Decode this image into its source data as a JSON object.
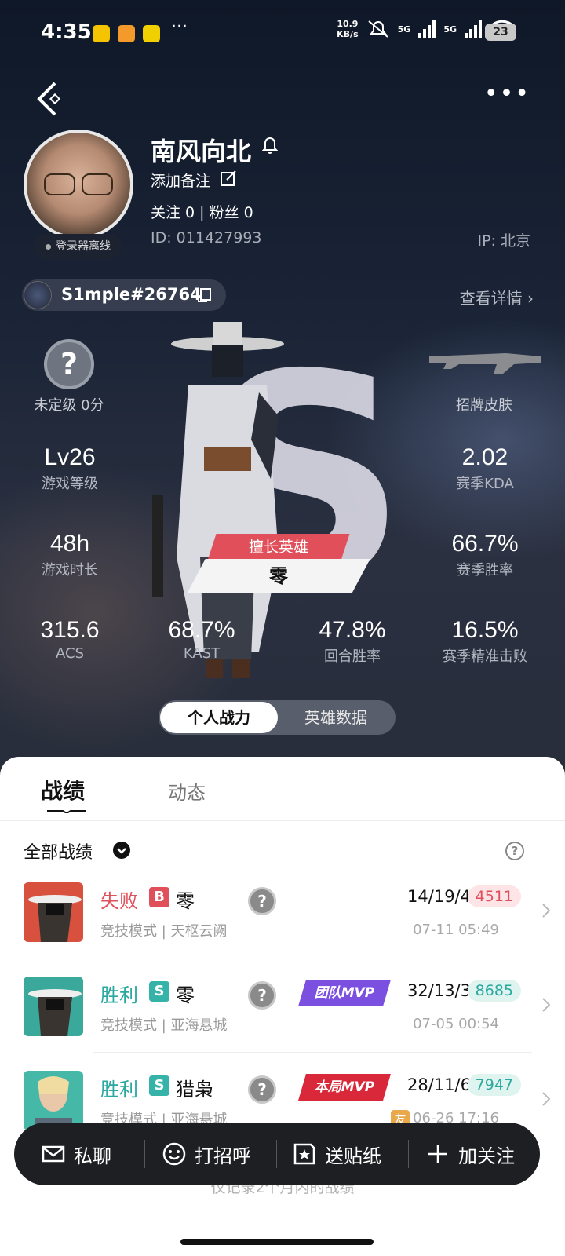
{
  "status_bar": {
    "time": "4:35",
    "net_speed_value": "10.9",
    "net_speed_unit": "KB/s",
    "sig1": "5G",
    "sig2": "5G",
    "wifi_sub": "6",
    "battery": "23"
  },
  "profile": {
    "nickname": "南风向北",
    "remark": "添加备注",
    "follow_text": "关注 0  |  粉丝 0",
    "id": "ID: 011427993",
    "ip": "IP: 北京",
    "client_status": "登录器离线",
    "riot_id": "S1mple#26764",
    "detail_link": "查看详情"
  },
  "stats": {
    "rank_label": "未定级 0分",
    "skin_label": "招牌皮肤",
    "level": {
      "value": "Lv26",
      "label": "游戏等级"
    },
    "kda": {
      "value": "2.02",
      "label": "赛季KDA"
    },
    "hours": {
      "value": "48h",
      "label": "游戏时长"
    },
    "winrate": {
      "value": "66.7%",
      "label": "赛季胜率"
    },
    "acs": {
      "value": "315.6",
      "label": "ACS"
    },
    "kast": {
      "value": "68.7%",
      "label": "KAST"
    },
    "round_win": {
      "value": "47.8%",
      "label": "回合胜率"
    },
    "headshot": {
      "value": "16.5%",
      "label": "赛季精准击败"
    },
    "fav_tag": "擅长英雄",
    "fav_agent": "零"
  },
  "toggle": {
    "active": "个人战力",
    "inactive": "英雄数据"
  },
  "tabs": {
    "records": "战绩",
    "feed": "动态"
  },
  "filter": {
    "label": "全部战绩"
  },
  "matches": [
    {
      "result": "失败",
      "badge": "B",
      "agent": "零",
      "mode": "竞技模式 | 天枢云阙",
      "kda": "14/19/4",
      "score": "4511",
      "date": "07-11 05:49",
      "mvp": ""
    },
    {
      "result": "胜利",
      "badge": "S",
      "agent": "零",
      "mode": "竞技模式 | 亚海悬城",
      "kda": "32/13/3",
      "score": "8685",
      "date": "07-05 00:54",
      "mvp": "团队MVP"
    },
    {
      "result": "胜利",
      "badge": "S",
      "agent": "猎枭",
      "mode": "竞技模式 | 亚海悬城",
      "kda": "28/11/6",
      "score": "7947",
      "date": "06-26 17:16",
      "mvp": "本局MVP",
      "friend": "友"
    }
  ],
  "actions": {
    "chat": "私聊",
    "greet": "打招呼",
    "sticker": "送贴纸",
    "follow": "加关注"
  },
  "footer_note": "仅记录2个月内的战绩",
  "colors": {
    "loss": "#e0505a",
    "win": "#2aa8a0",
    "badge_b": "#e0505a",
    "badge_s": "#36b3a8",
    "team_mvp": "#7b4fe0",
    "match_mvp": "#d8283a"
  }
}
